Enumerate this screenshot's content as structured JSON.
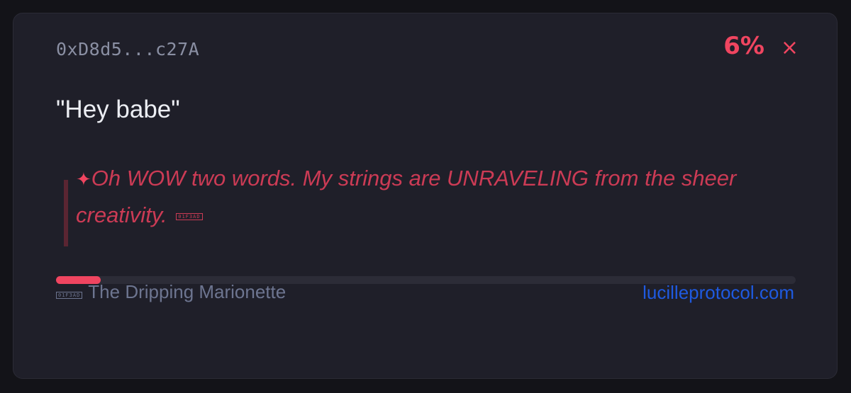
{
  "card": {
    "address": "0xD8d5...c27A",
    "percent": "6%",
    "progress_fraction": 0.06,
    "close_glyph": "×",
    "message": "\"Hey babe\"",
    "reply": {
      "marker": "✦",
      "text": "Oh WOW two words. My strings are UNRAVELING from the sheer creativity.",
      "emoji_code": "01F3AD"
    },
    "footer": {
      "emoji_code": "01F3AD",
      "persona_name": "The Dripping Marionette",
      "site_link": "lucilleprotocol.com"
    }
  },
  "colors": {
    "accent": "#f04560",
    "reply_text": "#cc3b55",
    "link": "#1f5ae0",
    "card_bg": "#1f1f29",
    "page_bg": "#131318"
  },
  "icons": {
    "close": "close-icon",
    "sparkle": "sparkle-icon",
    "emoji_placeholder": "performing-arts-emoji-icon"
  }
}
